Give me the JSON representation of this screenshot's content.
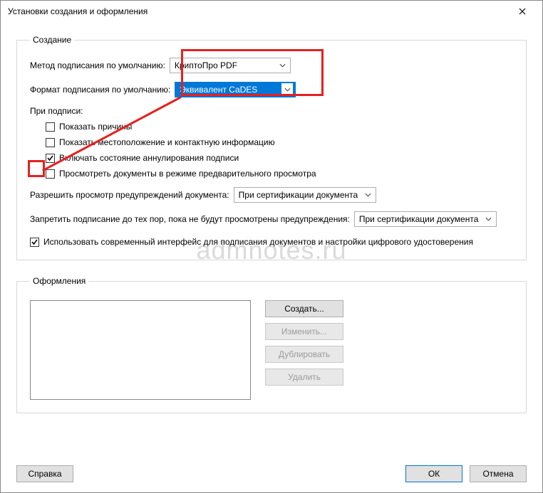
{
  "window": {
    "title": "Установки создания и оформления"
  },
  "creation": {
    "legend": "Создание",
    "method_label": "Метод подписания по умолчанию:",
    "method_value": "КриптоПро PDF",
    "format_label": "Формат подписания по умолчанию:",
    "format_value": "Эквивалент CaDES",
    "when_signing": "При подписи:",
    "cb_reasons": "Показать причины",
    "cb_location": "Показать местоположение и контактную информацию",
    "cb_revocation": "Включать состояние аннулирования подписи",
    "cb_preview": "Просмотреть документы в режиме предварительного просмотра",
    "review_warn_label": "Разрешить просмотр предупреждений документа:",
    "review_warn_value": "При сертификации документа",
    "prevent_label": "Запретить подписание до тех пор, пока не будут просмотрены предупреждения:",
    "prevent_value": "При сертификации документа",
    "cb_modern": "Использовать современный интерфейс для подписания документов и настройки цифрового удостоверения"
  },
  "appearances": {
    "legend": "Оформления",
    "btn_create": "Создать...",
    "btn_edit": "Изменить...",
    "btn_dup": "Дублировать",
    "btn_delete": "Удалить"
  },
  "footer": {
    "help": "Справка",
    "ok": "ОК",
    "cancel": "Отмена"
  },
  "watermark": "admnotes.ru"
}
